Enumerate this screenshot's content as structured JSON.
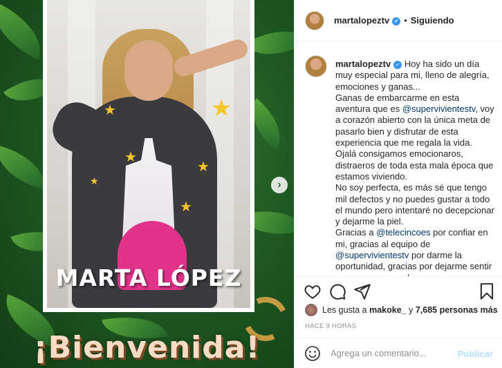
{
  "post": {
    "author": "martalopeztv",
    "verified_glyph": "✓",
    "separator": "•",
    "follow_status": "Siguiendo",
    "image": {
      "overlay_name": "MARTA LÓPEZ",
      "banner_text": "¡Bienvenida!",
      "next_glyph": "›"
    },
    "caption": {
      "line1": " Hoy ha sido un día muy especial para mi, lleno de alegría, emociones y ganas...",
      "p2_before": "Ganas de embarcarme en esta aventura que es ",
      "p2_mention": "@supervivientestv",
      "p2_after": ", voy a corazón abierto con la única meta de pasarlo bien y disfrutar de esta experiencia que me regala la vida. Ojalá consigamos emocionaros, distraeros de toda esta mala época que estamos viviendo.",
      "p3": "No soy perfecta, es más sé que tengo mil defectos y no puedes gustar a todo el mundo pero intentaré no decepcionar y dejarme la piel.",
      "p4_before": "Gracias a ",
      "p4_mention1": "@telecincoes",
      "p4_middle": " por confiar en mi, gracias al equipo de ",
      "p4_mention2": "@supervivientestv",
      "p4_after": " por darme la oportunidad, gracias por dejarme sentir eso que va a ser duro pero"
    },
    "likes": {
      "prefix": "Les gusta a ",
      "user": "makoke_",
      "middle": " y ",
      "count": "7,685 personas más"
    },
    "timestamp": "HACE 9 HORAS",
    "comment": {
      "placeholder": "Agrega un comentario...",
      "publish_label": "Publicar"
    }
  },
  "icons": {
    "like": "heart-icon",
    "comment": "comment-icon",
    "share": "share-icon",
    "save": "bookmark-icon",
    "emoji": "emoji-icon"
  },
  "colors": {
    "verified": "#3897f0",
    "mention": "#00376b",
    "publish_disabled": "#b2dffc",
    "timestamp": "#8e8e8e"
  }
}
